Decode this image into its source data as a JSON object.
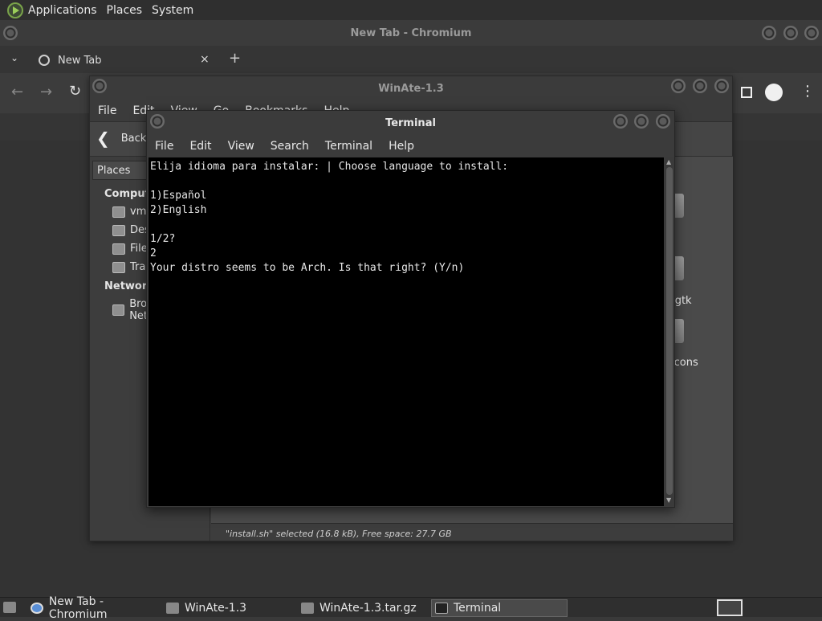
{
  "top_panel": {
    "menus": [
      "Applications",
      "Places",
      "System"
    ]
  },
  "chromium": {
    "title": "New Tab - Chromium",
    "tab_label": "New Tab",
    "tab_close": "×",
    "new_tab": "+"
  },
  "winate": {
    "title": "WinAte-1.3",
    "menu": [
      "File",
      "Edit",
      "View",
      "Go",
      "Bookmarks",
      "Help"
    ],
    "back_label": "Back",
    "sidebar_selector": "Places",
    "sidebar": {
      "computer_head": "Computer",
      "computer_items": [
        "vm",
        "Desktop",
        "File System",
        "Trash"
      ],
      "network_head": "Network",
      "network_items": [
        "Browse Network"
      ]
    },
    "visible_files": [
      "-gtk",
      "icons"
    ],
    "status": "\"install.sh\" selected (16.8 kB), Free space: 27.7 GB"
  },
  "terminal": {
    "title": "Terminal",
    "menu": [
      "File",
      "Edit",
      "View",
      "Search",
      "Terminal",
      "Help"
    ],
    "output": "Elija idioma para instalar: | Choose language to install:\n\n1)Español\n2)English\n\n1/2?\n2\nYour distro seems to be Arch. Is that right? (Y/n)"
  },
  "taskbar": {
    "items": [
      "New Tab - Chromium",
      "WinAte-1.3",
      "WinAte-1.3.tar.gz",
      "Terminal"
    ]
  }
}
